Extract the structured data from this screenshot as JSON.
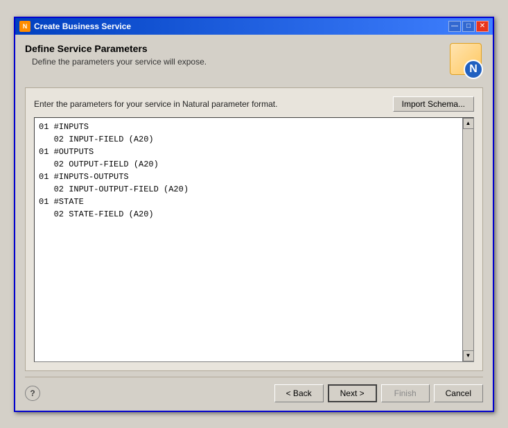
{
  "titlebar": {
    "title": "Create Business Service",
    "icon_label": "N",
    "min_label": "—",
    "max_label": "□",
    "close_label": "✕"
  },
  "header": {
    "title": "Define Service Parameters",
    "subtitle": "Define the parameters your service will expose.",
    "icon_letter": "N"
  },
  "panel": {
    "instruction": "Enter the parameters for your service in Natural parameter format.",
    "import_button_label": "Import Schema...",
    "text_content": "01 #INPUTS\n   02 INPUT-FIELD (A20)\n01 #OUTPUTS\n   02 OUTPUT-FIELD (A20)\n01 #INPUTS-OUTPUTS\n   02 INPUT-OUTPUT-FIELD (A20)\n01 #STATE\n   02 STATE-FIELD (A20)"
  },
  "footer": {
    "help_label": "?",
    "back_label": "< Back",
    "next_label": "Next >",
    "finish_label": "Finish",
    "cancel_label": "Cancel"
  }
}
